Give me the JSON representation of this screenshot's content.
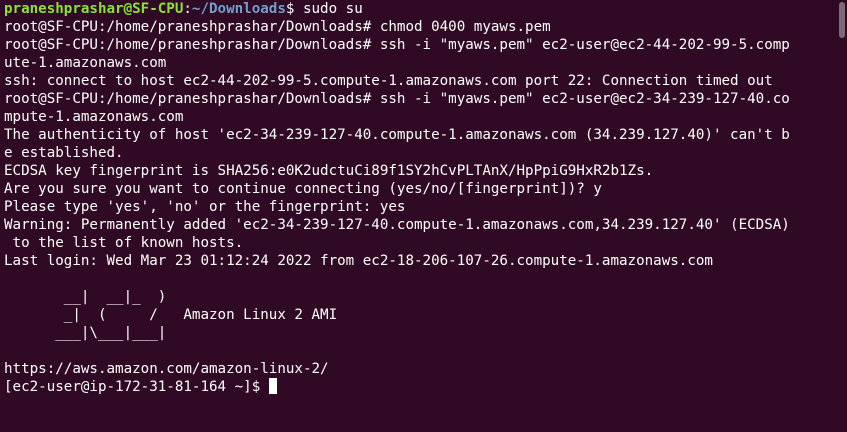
{
  "prompt": {
    "user_host": "praneshprashar@SF-CPU",
    "colon": ":",
    "path": "~/Downloads",
    "symbol": "$",
    "command": " sudo su"
  },
  "lines": [
    "root@SF-CPU:/home/praneshprashar/Downloads# chmod 0400 myaws.pem",
    "root@SF-CPU:/home/praneshprashar/Downloads# ssh -i \"myaws.pem\" ec2-user@ec2-44-202-99-5.comp",
    "ute-1.amazonaws.com",
    "ssh: connect to host ec2-44-202-99-5.compute-1.amazonaws.com port 22: Connection timed out",
    "root@SF-CPU:/home/praneshprashar/Downloads# ssh -i \"myaws.pem\" ec2-user@ec2-34-239-127-40.co",
    "mpute-1.amazonaws.com",
    "The authenticity of host 'ec2-34-239-127-40.compute-1.amazonaws.com (34.239.127.40)' can't b",
    "e established.",
    "ECDSA key fingerprint is SHA256:e0K2udctuCi89f1SY2hCvPLTAnX/HpPpiG9HxR2b1Zs.",
    "Are you sure you want to continue connecting (yes/no/[fingerprint])? y",
    "Please type 'yes', 'no' or the fingerprint: yes",
    "Warning: Permanently added 'ec2-34-239-127-40.compute-1.amazonaws.com,34.239.127.40' (ECDSA)",
    " to the list of known hosts.",
    "Last login: Wed Mar 23 01:12:24 2022 from ec2-18-206-107-26.compute-1.amazonaws.com",
    "",
    "       __|  __|_  )",
    "       _|  (     /   Amazon Linux 2 AMI",
    "      ___|\\___|___|",
    "",
    "https://aws.amazon.com/amazon-linux-2/"
  ],
  "final_prompt": "[ec2-user@ip-172-31-81-164 ~]$ ",
  "colors": {
    "background": "#300a24",
    "foreground": "#ffffff",
    "user_host": "#8ae234",
    "path": "#729fcf"
  }
}
